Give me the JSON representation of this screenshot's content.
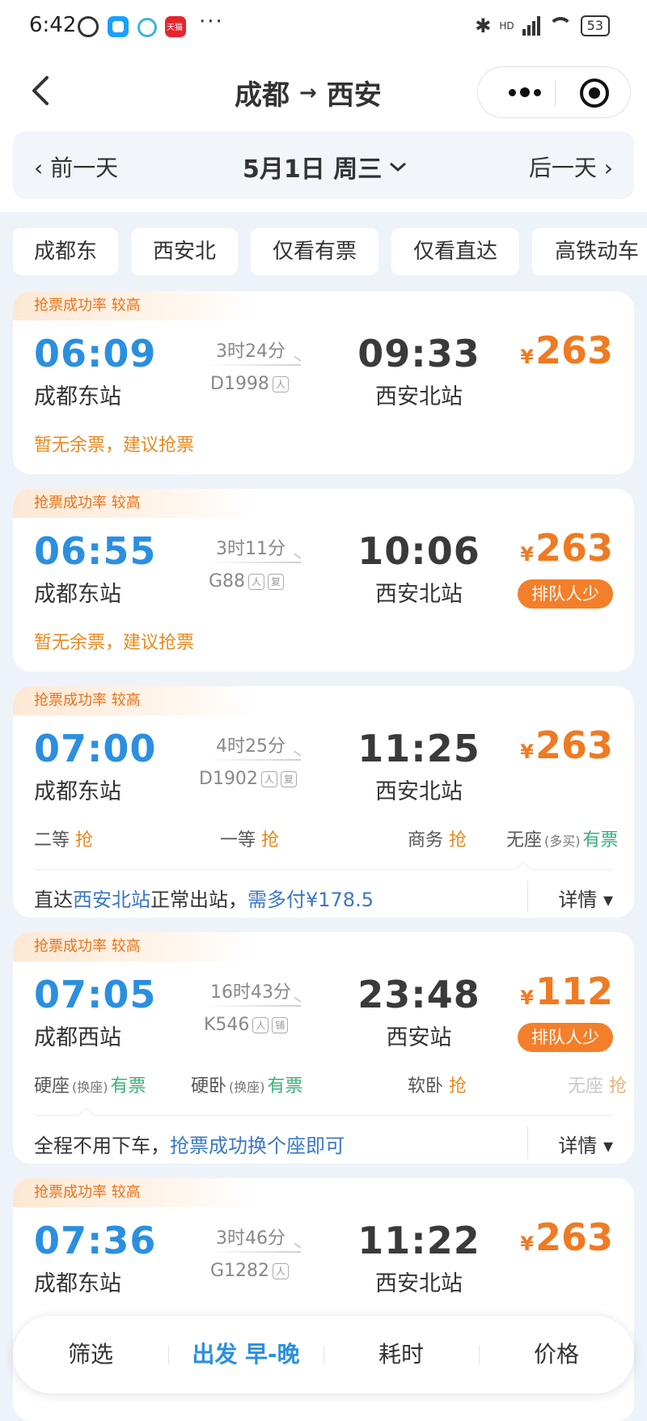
{
  "status_bar": {
    "time": "6:42",
    "app_badge": "天猫",
    "more": "···",
    "hd": "HD",
    "battery": "53"
  },
  "header": {
    "from": "成都",
    "to": "西安",
    "arrow": "→"
  },
  "date_bar": {
    "prev": "前一天",
    "date": "5月1日 周三",
    "next": "后一天"
  },
  "filters": [
    "成都东",
    "西安北",
    "仅看有票",
    "仅看直达",
    "高铁动车"
  ],
  "trains": [
    {
      "badge": "抢票成功率 较高",
      "dep_time": "06:09",
      "dep_station": "成都东站",
      "duration": "3时24分",
      "train_no": "D1998",
      "icons": [
        "人"
      ],
      "arr_time": "09:33",
      "arr_station": "西安北站",
      "currency": "¥",
      "price": "263",
      "note": "暂无余票，建议抢票"
    },
    {
      "badge": "抢票成功率 较高",
      "dep_time": "06:55",
      "dep_station": "成都东站",
      "duration": "3时11分",
      "train_no": "G88",
      "icons": [
        "人",
        "复"
      ],
      "arr_time": "10:06",
      "arr_station": "西安北站",
      "currency": "¥",
      "price": "263",
      "queue": "排队人少",
      "note": "暂无余票，建议抢票"
    },
    {
      "badge": "抢票成功率 较高",
      "dep_time": "07:00",
      "dep_station": "成都东站",
      "duration": "4时25分",
      "train_no": "D1902",
      "icons": [
        "人",
        "复"
      ],
      "arr_time": "11:25",
      "arr_station": "西安北站",
      "currency": "¥",
      "price": "263",
      "seats": [
        {
          "name": "二等",
          "status": "抢"
        },
        {
          "name": "一等",
          "status": "抢"
        },
        {
          "name": "商务",
          "status": "抢"
        },
        {
          "name": "无座",
          "sub": "(多买)",
          "status": "有票"
        }
      ],
      "info": {
        "p1": "直达",
        "p2": "西安北站",
        "p3": "正常出站，",
        "p4": "需多付¥178.5"
      },
      "detail": "详情 ▾"
    },
    {
      "badge": "抢票成功率 较高",
      "dep_time": "07:05",
      "dep_station": "成都西站",
      "duration": "16时43分",
      "train_no": "K546",
      "icons": [
        "人",
        "铺"
      ],
      "arr_time": "23:48",
      "arr_station": "西安站",
      "currency": "¥",
      "price": "112",
      "queue": "排队人少",
      "seats": [
        {
          "name": "硬座",
          "sub": "(换座)",
          "status": "有票"
        },
        {
          "name": "硬卧",
          "sub": "(换座)",
          "status": "有票"
        },
        {
          "name": "软卧",
          "status": "抢"
        },
        {
          "name": "无座",
          "status": "抢"
        }
      ],
      "info": {
        "p1": "全程不用下车，",
        "p2": "抢票成功换个座即可"
      },
      "detail": "详情 ▾"
    },
    {
      "badge": "抢票成功率 较高",
      "dep_time": "07:36",
      "dep_station": "成都东站",
      "duration": "3时46分",
      "train_no": "G1282",
      "icons": [
        "人"
      ],
      "arr_time": "11:22",
      "arr_station": "西安北站",
      "currency": "¥",
      "price": "263"
    }
  ],
  "bottom_bar": {
    "filter": "筛选",
    "depart": "出发 早-晚",
    "duration": "耗时",
    "price": "价格"
  },
  "colors": {
    "blue": "#2b8fe0",
    "orange": "#f07a21",
    "green": "#3bb07a"
  }
}
